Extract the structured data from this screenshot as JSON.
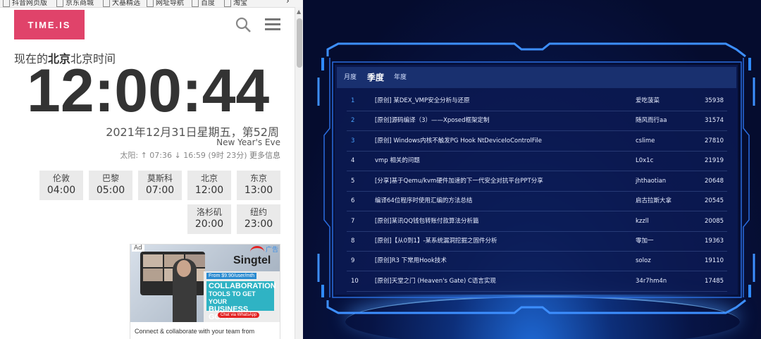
{
  "bookmarks": [
    "抖音网页版",
    "京东商城",
    "大基精选",
    "网址导航",
    "百度",
    "淘宝"
  ],
  "timeis": {
    "logo": "TIME.IS",
    "heading_prefix": "现在的",
    "heading_city": "北京",
    "heading_suffix": "北京时间",
    "clock": "12:00:44",
    "date": "2021年12月31日星期五，第52周",
    "holiday": "New Year's Eve",
    "sun": "太阳: ↑ 07:36 ↓ 16:59 (9时 23分)",
    "sun_more": "更多信息",
    "cities": [
      {
        "name": "伦敦",
        "time": "04:00"
      },
      {
        "name": "巴黎",
        "time": "05:00"
      },
      {
        "name": "莫斯科",
        "time": "07:00"
      },
      {
        "name": "北京",
        "time": "12:00"
      },
      {
        "name": "东京",
        "time": "13:00"
      },
      {
        "name": "洛杉矶",
        "time": "20:00"
      },
      {
        "name": "纽约",
        "time": "23:00"
      }
    ],
    "ad": {
      "label": "Ad",
      "tag": "广告",
      "brand": "Singtel",
      "price": "From $9.90/user/mth",
      "line1": "COLLABORATION",
      "line2": "TOOLS TO GET YOUR",
      "line3": "BUSINESS GOING",
      "cta": "Chat via WhatsApp",
      "caption": "Connect & collaborate with your team from"
    }
  },
  "dashboard": {
    "tabs": [
      "月度",
      "季度",
      "年度"
    ],
    "active_tab": "季度",
    "rows": [
      {
        "rank": "1",
        "title": "[原创] 某DEX_VMP安全分析与还原",
        "author": "爱吃菠菜",
        "count": "35938"
      },
      {
        "rank": "2",
        "title": "[原创]源码编译（3）——Xposed框架定制",
        "author": "随风而行aa",
        "count": "31574"
      },
      {
        "rank": "3",
        "title": "[原创] Windows内核不触发PG Hook NtDeviceIoControlFile",
        "author": "cslime",
        "count": "27810"
      },
      {
        "rank": "4",
        "title": "vmp 相关的问题",
        "author": "L0x1c",
        "count": "21919"
      },
      {
        "rank": "5",
        "title": "[分享]基于Qemu/kvm硬件加速的下一代安全对抗平台PPT分享",
        "author": "jhthaotian",
        "count": "20648"
      },
      {
        "rank": "6",
        "title": "编译64位程序时使用汇编的方法总结",
        "author": "启古拉斯大拿",
        "count": "20545"
      },
      {
        "rank": "7",
        "title": "[原创]某讯QQ钱包转账付款算法分析篇",
        "author": "kzzll",
        "count": "20085"
      },
      {
        "rank": "8",
        "title": "[原创]【从0到1】-某系统漏洞挖掘之固件分析",
        "author": "零加一",
        "count": "19363"
      },
      {
        "rank": "9",
        "title": "[原创]R3 下常用Hook技术",
        "author": "soloz",
        "count": "19110"
      },
      {
        "rank": "10",
        "title": "[原创]天堂之门 (Heaven's Gate) C语言实现",
        "author": "34r7hm4n",
        "count": "17485"
      }
    ],
    "colors": {
      "accent": "#2f8bff",
      "frame": "#3d8fff",
      "panel": "#0c1a52"
    }
  }
}
